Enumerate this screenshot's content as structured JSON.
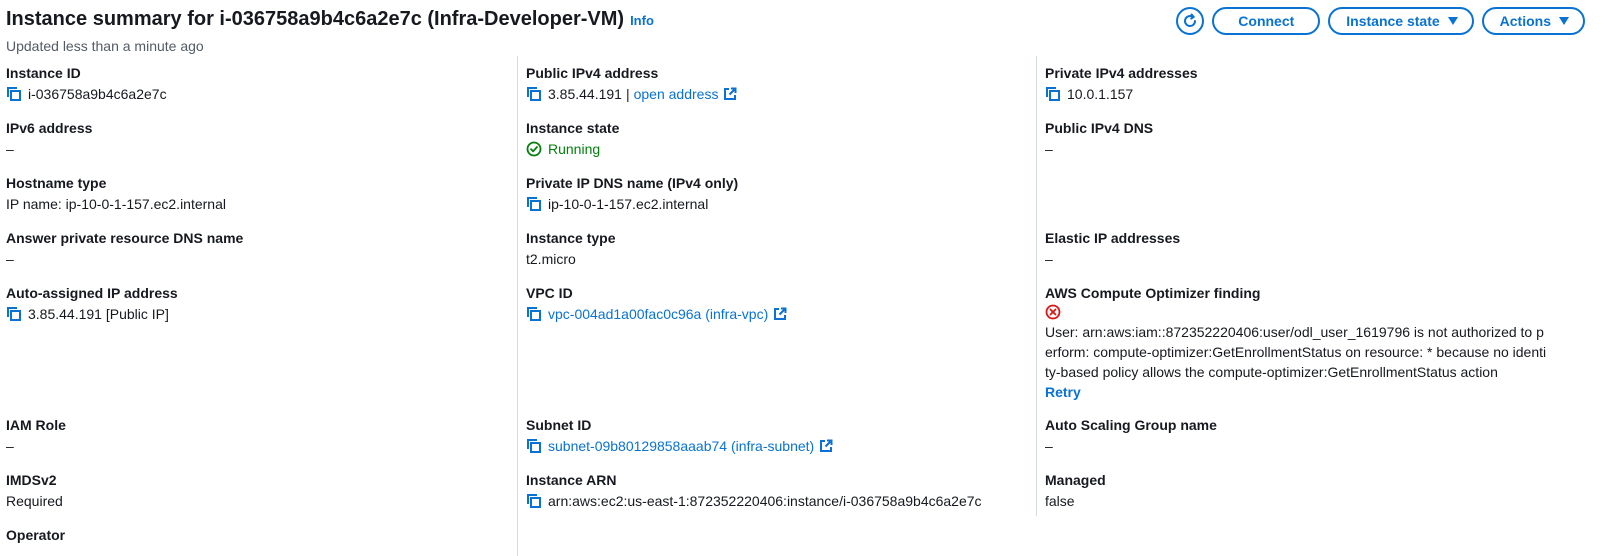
{
  "header": {
    "title": "Instance summary for i-036758a9b4c6a2e7c (Infra-Developer-VM)",
    "info_label": "Info",
    "updated": "Updated less than a minute ago",
    "connect_label": "Connect",
    "instance_state_label": "Instance state",
    "actions_label": "Actions"
  },
  "fields": {
    "instance_id": {
      "label": "Instance ID",
      "value": "i-036758a9b4c6a2e7c"
    },
    "ipv6": {
      "label": "IPv6 address",
      "value": "–"
    },
    "hostname_type": {
      "label": "Hostname type",
      "value": "IP name: ip-10-0-1-157.ec2.internal"
    },
    "answer_dns": {
      "label": "Answer private resource DNS name",
      "value": "–"
    },
    "auto_ip": {
      "label": "Auto-assigned IP address",
      "value": "3.85.44.191 [Public IP]"
    },
    "iam_role": {
      "label": "IAM Role",
      "value": "–"
    },
    "imdsv2": {
      "label": "IMDSv2",
      "value": "Required"
    },
    "operator": {
      "label": "Operator"
    },
    "public_ipv4": {
      "label": "Public IPv4 address",
      "value": "3.85.44.191",
      "separator": "|",
      "link": "open address"
    },
    "instance_state": {
      "label": "Instance state",
      "value": "Running"
    },
    "private_dns": {
      "label": "Private IP DNS name (IPv4 only)",
      "value": "ip-10-0-1-157.ec2.internal"
    },
    "instance_type": {
      "label": "Instance type",
      "value": "t2.micro"
    },
    "vpc_id": {
      "label": "VPC ID",
      "value": "vpc-004ad1a00fac0c96a (infra-vpc)"
    },
    "subnet_id": {
      "label": "Subnet ID",
      "value": "subnet-09b80129858aaab74 (infra-subnet)"
    },
    "instance_arn": {
      "label": "Instance ARN",
      "value": "arn:aws:ec2:us-east-1:872352220406:instance/i-036758a9b4c6a2e7c"
    },
    "private_ipv4": {
      "label": "Private IPv4 addresses",
      "value": "10.0.1.157"
    },
    "public_dns": {
      "label": "Public IPv4 DNS",
      "value": "–"
    },
    "elastic_ip": {
      "label": "Elastic IP addresses",
      "value": "–"
    },
    "optimizer": {
      "label": "AWS Compute Optimizer finding",
      "message": "User: arn:aws:iam::872352220406:user/odl_user_1619796 is not authorized to perform: compute-optimizer:GetEnrollmentStatus on resource: * because no identity-based policy allows the compute-optimizer:GetEnrollmentStatus action",
      "retry_label": "Retry"
    },
    "asg_name": {
      "label": "Auto Scaling Group name",
      "value": "–"
    },
    "managed": {
      "label": "Managed",
      "value": "false"
    }
  },
  "colors": {
    "link": "#0972d3",
    "running": "#037f0c",
    "error": "#d91515"
  }
}
